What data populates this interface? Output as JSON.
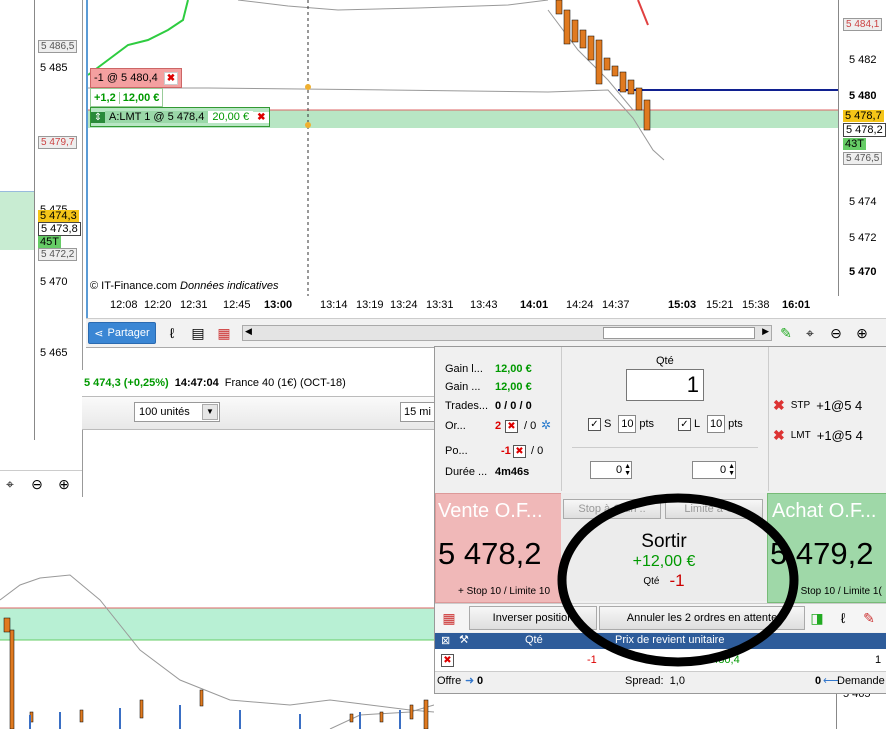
{
  "left_chart": {
    "price_labels": [
      "5 486,5",
      "5 485",
      "5 479,7",
      "5 475",
      "5 474,3",
      "5 473,8",
      "45T",
      "5 472,2",
      "5 470",
      "5 465"
    ],
    "colors": {
      "bid_zone": "#c8ecd2",
      "ask_line": "#e28a8a"
    }
  },
  "main_chart": {
    "y_labels": [
      "5 484,1",
      "5 482",
      "5 480",
      "5 478,7",
      "5 478,2",
      "43T",
      "5 476,5",
      "5 474",
      "5 472",
      "5 470"
    ],
    "x_labels": [
      "12:08",
      "12:20",
      "12:31",
      "12:45",
      "13:00",
      "13:14",
      "13:19",
      "13:24",
      "13:31",
      "13:43",
      "14:01",
      "14:24",
      "14:37",
      "15:03",
      "15:21",
      "15:38",
      "16:01"
    ],
    "bold_x_labels": [
      "13:00",
      "14:01",
      "15:03",
      "16:01"
    ],
    "copyright": "© IT-Finance.com",
    "copyright_note": "Données indicatives",
    "order_tag_sell": "-1 @ 5 480,4",
    "pnl_points": "+1,2",
    "pnl_euro": "12,00 €",
    "limit_order_tag": "A:LMT  1 @ 5 478,4",
    "limit_order_value": "20,00 €"
  },
  "toolbar": {
    "share_label": "Partager"
  },
  "instrument_bar": {
    "change": "5 474,3 (+0,25%)",
    "time": "14:47:04",
    "instrument": "France 40 (1€) (OCT-18)"
  },
  "order_controls": {
    "units_select": "100 unités",
    "timeframe_select": "15 mi"
  },
  "position_panel": {
    "stats": [
      {
        "label": "Gain l...",
        "value": "12,00 €"
      },
      {
        "label": "Gain ...",
        "value": "12,00 €"
      },
      {
        "label": "Trades...",
        "value": "0 / 0 / 0"
      },
      {
        "label": "Or...",
        "value": "2",
        "value2": "/ 0"
      },
      {
        "label": "Po...",
        "value": "-1",
        "value2": "/ 0"
      },
      {
        "label": "Durée ...",
        "value": "4m46s"
      }
    ],
    "qty_label": "Qté",
    "qty_value": "1",
    "stop_label": "S",
    "stop_pts": "10",
    "limit_label": "L",
    "limit_pts": "10",
    "pts_unit": "pts",
    "spin_left": "0",
    "spin_right": "0",
    "pending_orders": [
      {
        "type": "STP",
        "text": "+1@5 4"
      },
      {
        "type": "LMT",
        "text": "+1@5 4"
      }
    ],
    "sell_title": "Vente O.F...",
    "sell_price": "5 478,2",
    "sell_sub": "+ Stop 10 / Limite 10",
    "buy_title": "Achat O.F...",
    "buy_price": "5 479,2",
    "buy_sub": "+ Stop 10 / Limite 1(",
    "stop_button": "Stop à Gain ..",
    "limit_button": "Limite à G...",
    "exit_title": "Sortir",
    "exit_pnl": "+12,00 €",
    "exit_qty_label": "Qté",
    "exit_qty": "-1",
    "reverse_button": "Inverser position",
    "cancel_button": "Annuler les 2 ordres en attente",
    "table_headers": [
      "Qté",
      "Prix de revient unitaire"
    ],
    "table_row": {
      "qty": "-1",
      "price": "5 480,4",
      "last": "1"
    },
    "bottom": {
      "bid_label": "Offre",
      "bid_value": "0",
      "spread": "Spread:  1,0",
      "ask_value": "0",
      "ask_label": "Demande"
    }
  },
  "lower_chart": {
    "y_label": "5 465"
  }
}
